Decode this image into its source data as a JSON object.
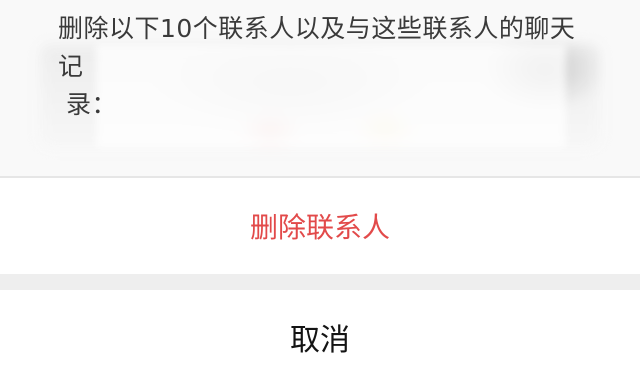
{
  "dialog": {
    "message_line1": "删除以下10个联系人以及与这些联系人的聊天记",
    "message_line2": "录：",
    "delete_label": "删除联系人",
    "cancel_label": "取消"
  },
  "colors": {
    "danger": "#e24a4a",
    "text": "#3a3a3a",
    "cancel_text": "#141414",
    "background": "#f4f4f4"
  }
}
